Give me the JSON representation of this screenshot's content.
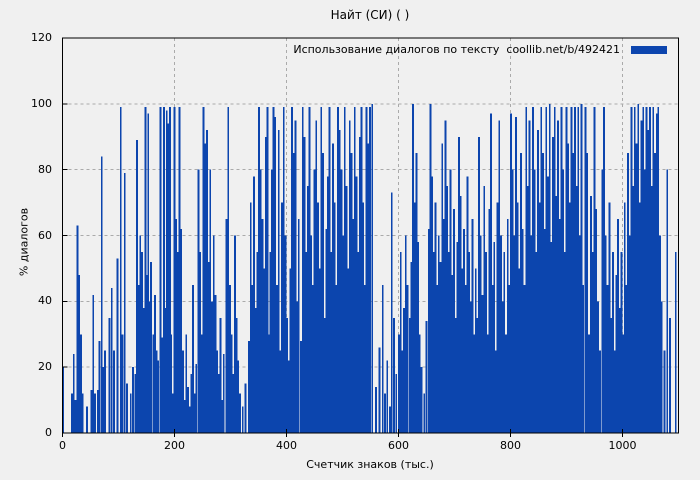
{
  "title": "Найт (СИ) ( )",
  "legend": {
    "label": "Использование диалогов по тексту  coollib.net/b/492421"
  },
  "axes": {
    "y_label": "% диалогов",
    "x_label": "Счетчик знаков (тыс.)",
    "y_ticks": [
      0,
      20,
      40,
      60,
      80,
      100,
      120
    ],
    "x_ticks": [
      0,
      200,
      400,
      600,
      800,
      1000
    ]
  },
  "colors": {
    "bar": "#0c45ae",
    "grid": "#aaaaaa",
    "background": "#f0f0f0",
    "border": "#000000",
    "text": "#000000"
  },
  "chart_data": {
    "type": "bar",
    "style": "impulses",
    "title": "Найт (СИ) ( )",
    "xlabel": "Счетчик знаков (тыс.)",
    "ylabel": "% диалогов",
    "legend": "Использование диалогов по тексту  coollib.net/b/492421",
    "xlim": [
      0,
      1100
    ],
    "ylim": [
      0,
      120
    ],
    "grid": true,
    "legend_position": "top-right",
    "points": [
      [
        1,
        20
      ],
      [
        17,
        12
      ],
      [
        20,
        24
      ],
      [
        23,
        10
      ],
      [
        27,
        63
      ],
      [
        30,
        48
      ],
      [
        33,
        30
      ],
      [
        36,
        12
      ],
      [
        44,
        8
      ],
      [
        52,
        13
      ],
      [
        55,
        42
      ],
      [
        58,
        12
      ],
      [
        63,
        13
      ],
      [
        66,
        28
      ],
      [
        70,
        84
      ],
      [
        73,
        20
      ],
      [
        76,
        25
      ],
      [
        84,
        35
      ],
      [
        88,
        44
      ],
      [
        92,
        25
      ],
      [
        98,
        53
      ],
      [
        104,
        99
      ],
      [
        107,
        30
      ],
      [
        111,
        79
      ],
      [
        115,
        15
      ],
      [
        122,
        12
      ],
      [
        126,
        20
      ],
      [
        130,
        18
      ],
      [
        133,
        89
      ],
      [
        136,
        45
      ],
      [
        139,
        60
      ],
      [
        142,
        55
      ],
      [
        145,
        38
      ],
      [
        148,
        99
      ],
      [
        151,
        48
      ],
      [
        153,
        97
      ],
      [
        156,
        40
      ],
      [
        158,
        52
      ],
      [
        162,
        30
      ],
      [
        165,
        42
      ],
      [
        168,
        25
      ],
      [
        171,
        22
      ],
      [
        175,
        99
      ],
      [
        178,
        29
      ],
      [
        181,
        99
      ],
      [
        183,
        38
      ],
      [
        186,
        98
      ],
      [
        189,
        94
      ],
      [
        192,
        99
      ],
      [
        194,
        30
      ],
      [
        197,
        12
      ],
      [
        200,
        99
      ],
      [
        203,
        65
      ],
      [
        206,
        55
      ],
      [
        209,
        99
      ],
      [
        212,
        62
      ],
      [
        215,
        25
      ],
      [
        218,
        10
      ],
      [
        221,
        30
      ],
      [
        224,
        14
      ],
      [
        227,
        8
      ],
      [
        230,
        18
      ],
      [
        233,
        45
      ],
      [
        236,
        12
      ],
      [
        239,
        21
      ],
      [
        243,
        80
      ],
      [
        246,
        55
      ],
      [
        249,
        30
      ],
      [
        252,
        99
      ],
      [
        255,
        88
      ],
      [
        258,
        92
      ],
      [
        261,
        52
      ],
      [
        264,
        80
      ],
      [
        267,
        40
      ],
      [
        270,
        60
      ],
      [
        273,
        42
      ],
      [
        276,
        25
      ],
      [
        279,
        18
      ],
      [
        282,
        35
      ],
      [
        285,
        10
      ],
      [
        288,
        24
      ],
      [
        293,
        65
      ],
      [
        296,
        99
      ],
      [
        299,
        45
      ],
      [
        302,
        30
      ],
      [
        305,
        18
      ],
      [
        308,
        60
      ],
      [
        311,
        35
      ],
      [
        314,
        22
      ],
      [
        317,
        12
      ],
      [
        322,
        8
      ],
      [
        327,
        15
      ],
      [
        333,
        28
      ],
      [
        336,
        70
      ],
      [
        339,
        45
      ],
      [
        342,
        78
      ],
      [
        345,
        38
      ],
      [
        348,
        55
      ],
      [
        351,
        99
      ],
      [
        354,
        80
      ],
      [
        357,
        65
      ],
      [
        360,
        50
      ],
      [
        363,
        90
      ],
      [
        366,
        99
      ],
      [
        368,
        30
      ],
      [
        371,
        55
      ],
      [
        374,
        80
      ],
      [
        377,
        99
      ],
      [
        380,
        96
      ],
      [
        383,
        45
      ],
      [
        386,
        92
      ],
      [
        389,
        25
      ],
      [
        392,
        70
      ],
      [
        395,
        99
      ],
      [
        398,
        60
      ],
      [
        401,
        35
      ],
      [
        404,
        22
      ],
      [
        407,
        50
      ],
      [
        410,
        99
      ],
      [
        413,
        85
      ],
      [
        416,
        95
      ],
      [
        419,
        40
      ],
      [
        422,
        65
      ],
      [
        426,
        28
      ],
      [
        429,
        99
      ],
      [
        432,
        90
      ],
      [
        435,
        55
      ],
      [
        438,
        75
      ],
      [
        441,
        99
      ],
      [
        444,
        60
      ],
      [
        447,
        45
      ],
      [
        450,
        80
      ],
      [
        453,
        95
      ],
      [
        456,
        70
      ],
      [
        459,
        50
      ],
      [
        462,
        99
      ],
      [
        465,
        85
      ],
      [
        468,
        35
      ],
      [
        471,
        62
      ],
      [
        474,
        78
      ],
      [
        477,
        99
      ],
      [
        480,
        55
      ],
      [
        483,
        88
      ],
      [
        486,
        70
      ],
      [
        489,
        45
      ],
      [
        492,
        99
      ],
      [
        495,
        92
      ],
      [
        498,
        80
      ],
      [
        501,
        60
      ],
      [
        504,
        99
      ],
      [
        507,
        75
      ],
      [
        510,
        50
      ],
      [
        513,
        95
      ],
      [
        516,
        85
      ],
      [
        519,
        65
      ],
      [
        522,
        99
      ],
      [
        525,
        78
      ],
      [
        528,
        55
      ],
      [
        531,
        90
      ],
      [
        534,
        99
      ],
      [
        537,
        70
      ],
      [
        540,
        45
      ],
      [
        543,
        99
      ],
      [
        546,
        88
      ],
      [
        549,
        99
      ],
      [
        553,
        100
      ],
      [
        560,
        14
      ],
      [
        566,
        26
      ],
      [
        572,
        45
      ],
      [
        576,
        12
      ],
      [
        580,
        22
      ],
      [
        585,
        8
      ],
      [
        588,
        73
      ],
      [
        592,
        35
      ],
      [
        596,
        18
      ],
      [
        601,
        30
      ],
      [
        604,
        55
      ],
      [
        607,
        25
      ],
      [
        610,
        38
      ],
      [
        613,
        60
      ],
      [
        616,
        45
      ],
      [
        620,
        35
      ],
      [
        623,
        52
      ],
      [
        626,
        100
      ],
      [
        629,
        70
      ],
      [
        632,
        85
      ],
      [
        635,
        58
      ],
      [
        638,
        30
      ],
      [
        641,
        20
      ],
      [
        646,
        12
      ],
      [
        650,
        34
      ],
      [
        654,
        62
      ],
      [
        657,
        100
      ],
      [
        660,
        78
      ],
      [
        663,
        55
      ],
      [
        666,
        70
      ],
      [
        669,
        45
      ],
      [
        672,
        60
      ],
      [
        675,
        52
      ],
      [
        678,
        88
      ],
      [
        681,
        65
      ],
      [
        684,
        95
      ],
      [
        687,
        75
      ],
      [
        690,
        55
      ],
      [
        693,
        80
      ],
      [
        696,
        48
      ],
      [
        699,
        68
      ],
      [
        702,
        35
      ],
      [
        705,
        58
      ],
      [
        708,
        90
      ],
      [
        711,
        72
      ],
      [
        714,
        50
      ],
      [
        717,
        62
      ],
      [
        720,
        45
      ],
      [
        723,
        78
      ],
      [
        726,
        55
      ],
      [
        729,
        40
      ],
      [
        732,
        65
      ],
      [
        735,
        30
      ],
      [
        738,
        50
      ],
      [
        741,
        35
      ],
      [
        744,
        90
      ],
      [
        747,
        60
      ],
      [
        750,
        42
      ],
      [
        753,
        75
      ],
      [
        756,
        55
      ],
      [
        759,
        30
      ],
      [
        762,
        68
      ],
      [
        765,
        97
      ],
      [
        768,
        45
      ],
      [
        771,
        58
      ],
      [
        774,
        25
      ],
      [
        777,
        70
      ],
      [
        780,
        95
      ],
      [
        783,
        60
      ],
      [
        786,
        40
      ],
      [
        789,
        55
      ],
      [
        792,
        30
      ],
      [
        795,
        65
      ],
      [
        798,
        45
      ],
      [
        801,
        97
      ],
      [
        804,
        80
      ],
      [
        807,
        60
      ],
      [
        810,
        96
      ],
      [
        813,
        70
      ],
      [
        816,
        50
      ],
      [
        819,
        85
      ],
      [
        822,
        62
      ],
      [
        825,
        45
      ],
      [
        828,
        99
      ],
      [
        831,
        75
      ],
      [
        834,
        95
      ],
      [
        837,
        60
      ],
      [
        840,
        99
      ],
      [
        843,
        80
      ],
      [
        846,
        55
      ],
      [
        849,
        92
      ],
      [
        852,
        70
      ],
      [
        855,
        99
      ],
      [
        858,
        85
      ],
      [
        861,
        62
      ],
      [
        864,
        99
      ],
      [
        867,
        78
      ],
      [
        870,
        100
      ],
      [
        873,
        58
      ],
      [
        876,
        90
      ],
      [
        879,
        99
      ],
      [
        882,
        72
      ],
      [
        885,
        95
      ],
      [
        888,
        65
      ],
      [
        891,
        99
      ],
      [
        894,
        80
      ],
      [
        897,
        55
      ],
      [
        900,
        99
      ],
      [
        903,
        88
      ],
      [
        906,
        70
      ],
      [
        909,
        99
      ],
      [
        912,
        85
      ],
      [
        915,
        99
      ],
      [
        918,
        75
      ],
      [
        921,
        99
      ],
      [
        924,
        60
      ],
      [
        927,
        100
      ],
      [
        930,
        45
      ],
      [
        934,
        99
      ],
      [
        937,
        85
      ],
      [
        940,
        30
      ],
      [
        944,
        72
      ],
      [
        947,
        55
      ],
      [
        950,
        99
      ],
      [
        953,
        68
      ],
      [
        956,
        40
      ],
      [
        960,
        25
      ],
      [
        964,
        80
      ],
      [
        967,
        99
      ],
      [
        970,
        60
      ],
      [
        973,
        45
      ],
      [
        977,
        70
      ],
      [
        980,
        35
      ],
      [
        983,
        55
      ],
      [
        986,
        25
      ],
      [
        989,
        48
      ],
      [
        992,
        65
      ],
      [
        995,
        38
      ],
      [
        998,
        55
      ],
      [
        1001,
        30
      ],
      [
        1004,
        70
      ],
      [
        1007,
        45
      ],
      [
        1010,
        85
      ],
      [
        1013,
        60
      ],
      [
        1016,
        99
      ],
      [
        1019,
        75
      ],
      [
        1022,
        99
      ],
      [
        1025,
        88
      ],
      [
        1028,
        100
      ],
      [
        1031,
        70
      ],
      [
        1034,
        95
      ],
      [
        1037,
        99
      ],
      [
        1040,
        80
      ],
      [
        1043,
        99
      ],
      [
        1046,
        92
      ],
      [
        1049,
        99
      ],
      [
        1052,
        75
      ],
      [
        1055,
        99
      ],
      [
        1058,
        85
      ],
      [
        1061,
        97
      ],
      [
        1064,
        99
      ],
      [
        1067,
        60
      ],
      [
        1070,
        40
      ],
      [
        1075,
        25
      ],
      [
        1080,
        80
      ],
      [
        1085,
        35
      ],
      [
        1095,
        55
      ]
    ]
  }
}
